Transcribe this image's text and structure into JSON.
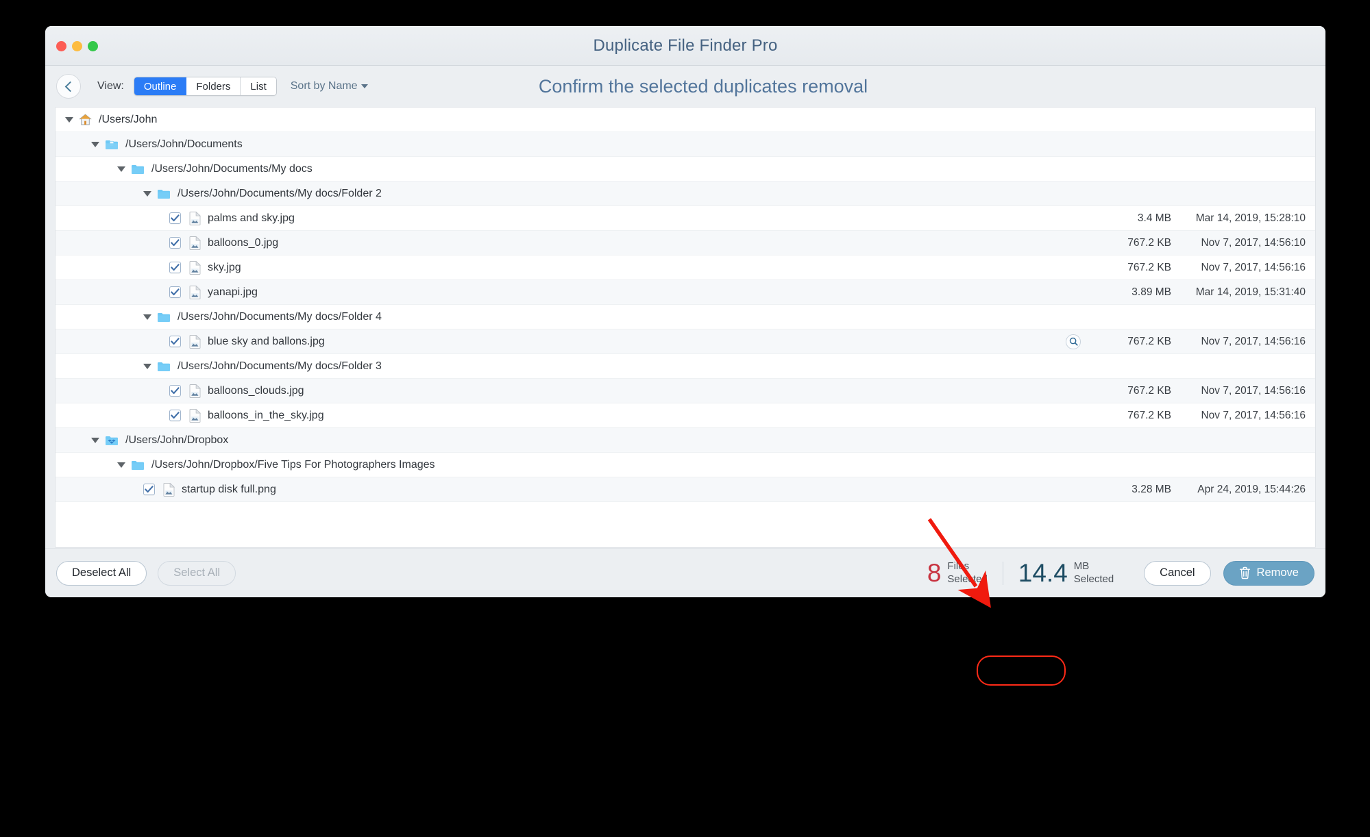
{
  "window": {
    "title": "Duplicate File Finder Pro",
    "traffic_lights": [
      "close",
      "minimize",
      "zoom"
    ]
  },
  "toolbar": {
    "back_label": "back",
    "view_label": "View:",
    "view_options": [
      "Outline",
      "Folders",
      "List"
    ],
    "view_selected": "Outline",
    "sort_label": "Sort by Name",
    "headline": "Confirm the selected duplicates removal"
  },
  "list": {
    "rows": [
      {
        "type": "folder",
        "icon": "home-icon",
        "depth": 0,
        "label": "/Users/John",
        "size": "",
        "date": "",
        "checked": null,
        "expanded": true,
        "shade": "white",
        "hovered": false
      },
      {
        "type": "folder",
        "icon": "documents-folder-icon",
        "depth": 1,
        "label": "/Users/John/Documents",
        "size": "",
        "date": "",
        "checked": null,
        "expanded": true,
        "shade": "alt",
        "hovered": false
      },
      {
        "type": "folder",
        "icon": "folder-icon",
        "depth": 2,
        "label": "/Users/John/Documents/My docs",
        "size": "",
        "date": "",
        "checked": null,
        "expanded": true,
        "shade": "white",
        "hovered": false
      },
      {
        "type": "folder",
        "icon": "folder-icon",
        "depth": 3,
        "label": "/Users/John/Documents/My docs/Folder 2",
        "size": "",
        "date": "",
        "checked": null,
        "expanded": true,
        "shade": "alt",
        "hovered": false
      },
      {
        "type": "file",
        "icon": "image-file-icon",
        "depth": 4,
        "label": "palms and sky.jpg",
        "size": "3.4 MB",
        "date": "Mar 14, 2019, 15:28:10",
        "checked": true,
        "expanded": null,
        "shade": "white",
        "hovered": false
      },
      {
        "type": "file",
        "icon": "image-file-icon",
        "depth": 4,
        "label": "balloons_0.jpg",
        "size": "767.2 KB",
        "date": "Nov 7, 2017, 14:56:10",
        "checked": true,
        "expanded": null,
        "shade": "alt",
        "hovered": false
      },
      {
        "type": "file",
        "icon": "image-file-icon",
        "depth": 4,
        "label": "sky.jpg",
        "size": "767.2 KB",
        "date": "Nov 7, 2017, 14:56:16",
        "checked": true,
        "expanded": null,
        "shade": "white",
        "hovered": false
      },
      {
        "type": "file",
        "icon": "image-file-icon",
        "depth": 4,
        "label": "yanapi.jpg",
        "size": "3.89 MB",
        "date": "Mar 14, 2019, 15:31:40",
        "checked": true,
        "expanded": null,
        "shade": "alt",
        "hovered": false
      },
      {
        "type": "folder",
        "icon": "folder-icon",
        "depth": 3,
        "label": "/Users/John/Documents/My docs/Folder 4",
        "size": "",
        "date": "",
        "checked": null,
        "expanded": true,
        "shade": "white",
        "hovered": false
      },
      {
        "type": "file",
        "icon": "image-file-icon",
        "depth": 4,
        "label": "blue sky and ballons.jpg",
        "size": "767.2 KB",
        "date": "Nov 7, 2017, 14:56:16",
        "checked": true,
        "expanded": null,
        "shade": "alt",
        "hovered": true
      },
      {
        "type": "folder",
        "icon": "folder-icon",
        "depth": 3,
        "label": "/Users/John/Documents/My docs/Folder 3",
        "size": "",
        "date": "",
        "checked": null,
        "expanded": true,
        "shade": "white",
        "hovered": false
      },
      {
        "type": "file",
        "icon": "image-file-icon",
        "depth": 4,
        "label": "balloons_clouds.jpg",
        "size": "767.2 KB",
        "date": "Nov 7, 2017, 14:56:16",
        "checked": true,
        "expanded": null,
        "shade": "alt",
        "hovered": false
      },
      {
        "type": "file",
        "icon": "image-file-icon",
        "depth": 4,
        "label": "balloons_in_the_sky.jpg",
        "size": "767.2 KB",
        "date": "Nov 7, 2017, 14:56:16",
        "checked": true,
        "expanded": null,
        "shade": "white",
        "hovered": false
      },
      {
        "type": "folder",
        "icon": "dropbox-folder-icon",
        "depth": 1,
        "label": "/Users/John/Dropbox",
        "size": "",
        "date": "",
        "checked": null,
        "expanded": true,
        "shade": "alt",
        "hovered": false
      },
      {
        "type": "folder",
        "icon": "folder-icon",
        "depth": 2,
        "label": "/Users/John/Dropbox/Five Tips For Photographers Images",
        "size": "",
        "date": "",
        "checked": null,
        "expanded": true,
        "shade": "white",
        "hovered": false
      },
      {
        "type": "file",
        "icon": "image-file-icon",
        "depth": 3,
        "label": "startup disk full.png",
        "size": "3.28 MB",
        "date": "Apr 24, 2019, 15:44:26",
        "checked": true,
        "expanded": null,
        "shade": "alt",
        "hovered": false
      }
    ]
  },
  "bottom": {
    "deselect_all": "Deselect All",
    "select_all": "Select All",
    "files_count": "8",
    "files_line1": "Files",
    "files_line2": "Selected",
    "size_value": "14.4",
    "size_line1": "MB",
    "size_line2": "Selected",
    "cancel": "Cancel",
    "remove": "Remove"
  },
  "annotation": {
    "arrow_color": "#f01a0e",
    "points_to": "remove-button"
  },
  "colors": {
    "accent_blue": "#2b7cf6",
    "title_blue": "#456281",
    "headline_blue": "#52759b",
    "count_red": "#c8323f",
    "size_teal": "#1d4c63",
    "remove_blue": "#6ba3c4"
  }
}
